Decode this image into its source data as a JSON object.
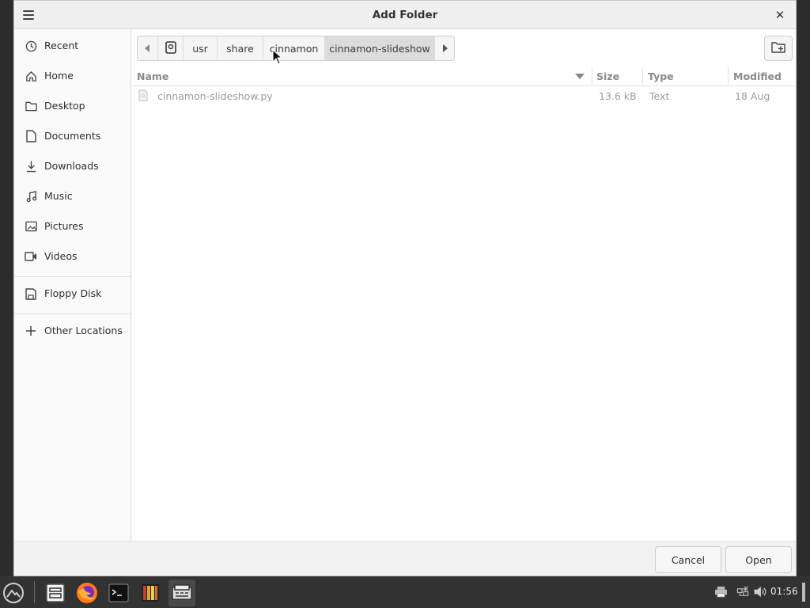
{
  "window": {
    "title": "Add Folder",
    "close_glyph": "✕"
  },
  "sidebar": {
    "items": [
      {
        "label": "Recent",
        "icon": "clock-icon"
      },
      {
        "label": "Home",
        "icon": "home-icon"
      },
      {
        "label": "Desktop",
        "icon": "folder-icon"
      },
      {
        "label": "Documents",
        "icon": "document-icon"
      },
      {
        "label": "Downloads",
        "icon": "download-icon"
      },
      {
        "label": "Music",
        "icon": "music-icon"
      },
      {
        "label": "Pictures",
        "icon": "picture-icon"
      },
      {
        "label": "Videos",
        "icon": "video-icon"
      },
      {
        "label": "Floppy Disk",
        "icon": "floppy-icon"
      },
      {
        "label": "Other Locations",
        "icon": "plus-icon"
      }
    ]
  },
  "pathbar": {
    "segments": [
      "usr",
      "share",
      "cinnamon",
      "cinnamon-slideshow"
    ],
    "active": "cinnamon-slideshow"
  },
  "filelist": {
    "columns": {
      "name": "Name",
      "size": "Size",
      "type": "Type",
      "modified": "Modified"
    },
    "rows": [
      {
        "name": "cinnamon-slideshow.py",
        "size": "13.6 kB",
        "type": "Text",
        "modified": "18 Aug"
      }
    ]
  },
  "buttons": {
    "cancel": "Cancel",
    "open": "Open"
  },
  "taskbar": {
    "clock": "01:56",
    "apps": [
      "menu-icon",
      "file-manager-icon",
      "firefox-icon",
      "terminal-icon",
      "color-app-icon",
      "slideshow-app-icon"
    ]
  },
  "colors": {
    "accent_active_segment": "#dcdcdc",
    "taskbar": "#323232",
    "firefox_orange": "#ff7a1a"
  }
}
